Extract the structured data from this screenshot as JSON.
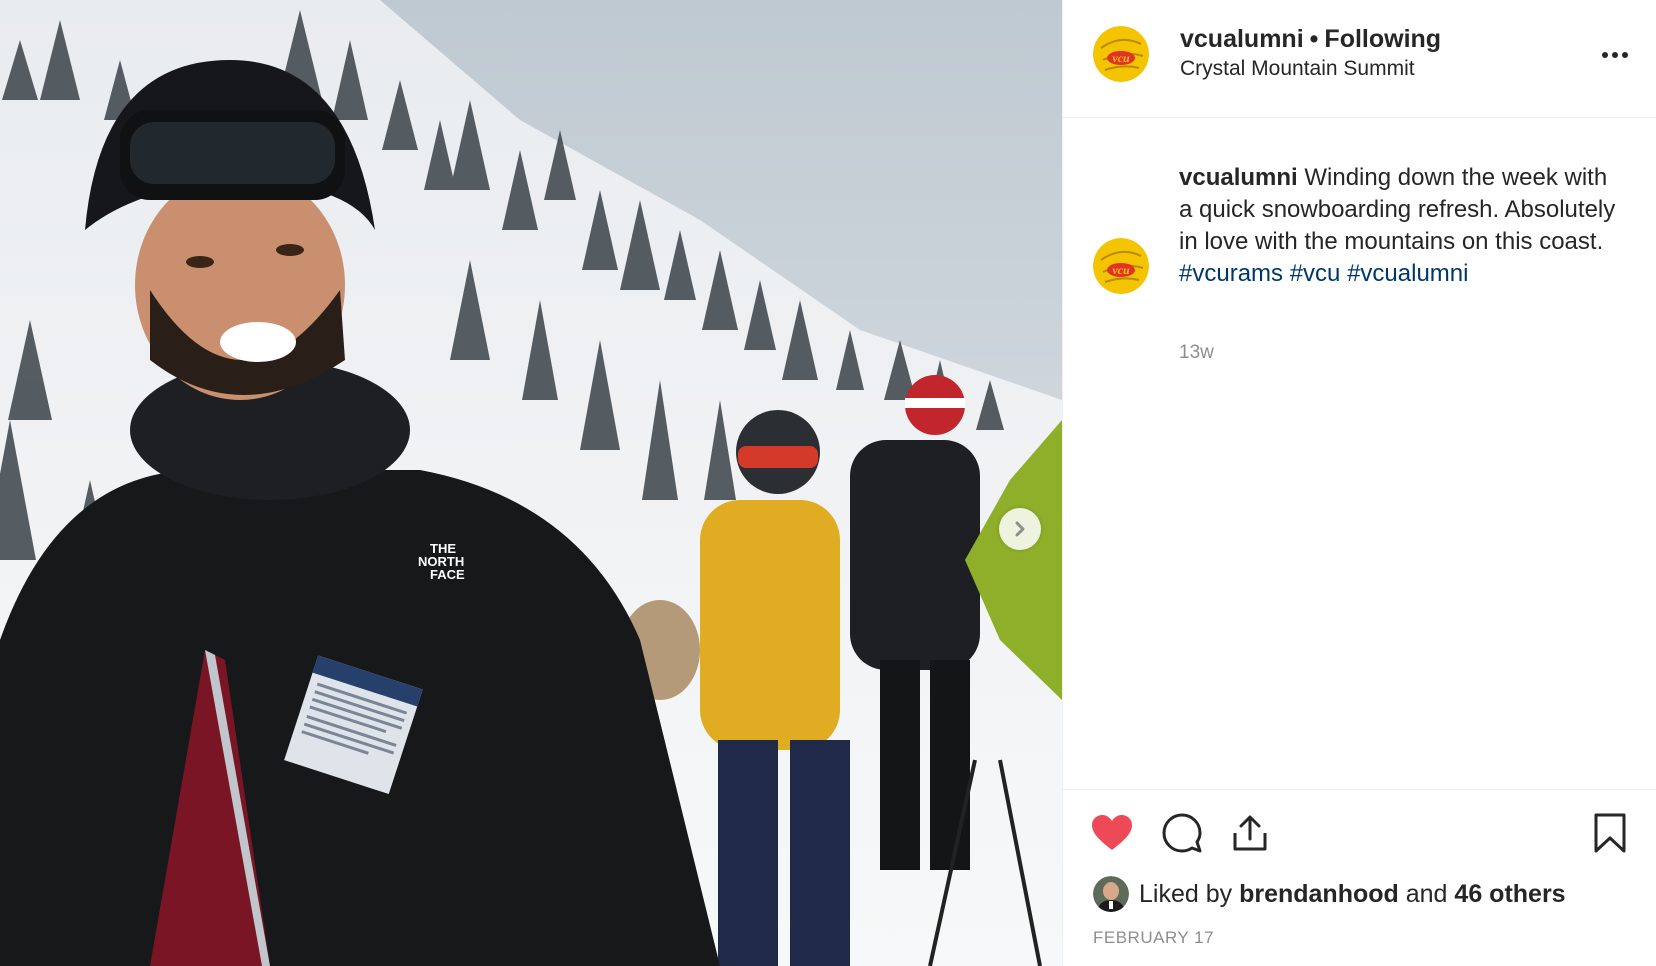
{
  "post": {
    "username": "vcualumni",
    "separator": "•",
    "follow_status": "Following",
    "location": "Crystal Mountain Summit",
    "avatar_text": "vcu",
    "caption": {
      "username": "vcualumni",
      "text": "Winding down the week with a quick snowboarding refresh. Absolutely in love with the mountains on this coast.",
      "hashtags": [
        "#vcurams",
        "#vcu",
        "#vcualumni"
      ]
    },
    "time_ago": "13w",
    "likes": {
      "prefix": "Liked by",
      "liker": "brendanhood",
      "joiner": "and",
      "others": "46 others"
    },
    "date": "FEBRUARY 17",
    "liked": true
  },
  "photo": {
    "jacket_logo": [
      "THE",
      "NORTH",
      "FACE"
    ]
  },
  "icons": {
    "more": "more-options-icon",
    "next": "chevron-right-icon",
    "like": "heart-icon",
    "comment": "comment-icon",
    "share": "share-icon",
    "save": "bookmark-icon"
  },
  "colors": {
    "like_red": "#ed4956",
    "hashtag": "#00376b",
    "muted": "#8e8e8e",
    "text": "#262626",
    "avatar_gold": "#f5c400"
  }
}
